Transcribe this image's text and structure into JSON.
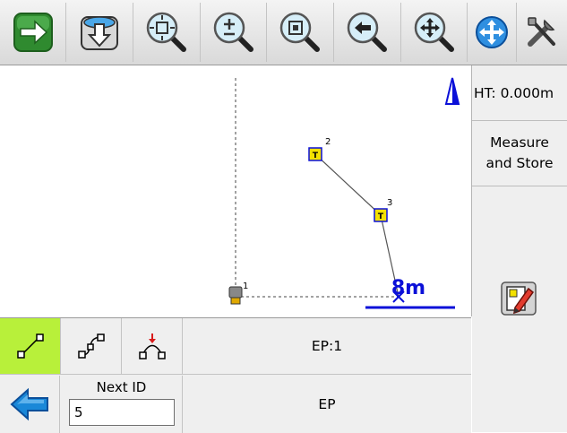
{
  "colors": {
    "toolbar_green": "#2f8a2f",
    "active_mode": "#b8f03a",
    "map_blue": "#0b10d8",
    "point_yellow": "#f3e100",
    "back_arrow_blue": "#1a88d8"
  },
  "toolbar": {
    "icons": [
      "forward-arrow-icon",
      "download-icon",
      "zoom-extents-icon",
      "zoom-in-out-icon",
      "zoom-window-icon",
      "zoom-previous-icon",
      "pan-icon",
      "globe-pan-icon",
      "tools-icon"
    ]
  },
  "map": {
    "points": [
      {
        "id": "1",
        "type": "instrument"
      },
      {
        "id": "2",
        "type": "traverse"
      },
      {
        "id": "3",
        "type": "traverse"
      }
    ],
    "scale_label": "8m",
    "north_icon": "north-arrow-icon"
  },
  "sidebar": {
    "ht_text": "HT: 0.000m",
    "measure_line1": "Measure",
    "measure_line2": "and Store",
    "edit_icon": "edit-notes-icon"
  },
  "bottom": {
    "modes": [
      "line-mode-icon",
      "curve-mode-icon",
      "arc-mode-icon"
    ],
    "active_mode": "line-mode-icon",
    "ep1_label": "EP:1",
    "next_id_label": "Next ID",
    "next_id_value": "5",
    "ep2_label": "EP"
  }
}
